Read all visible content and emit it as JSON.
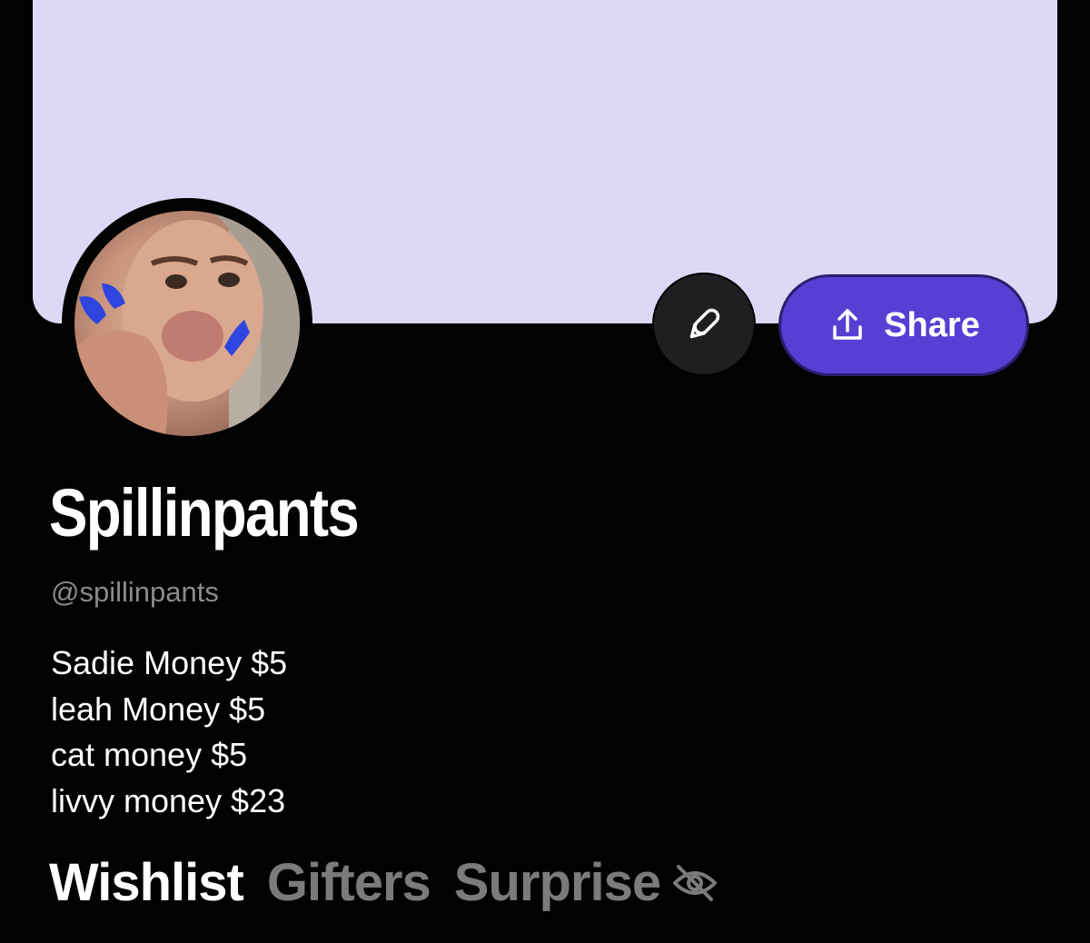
{
  "profile": {
    "display_name": "Spillinpants",
    "handle": "@spillinpants",
    "bio_lines": [
      "Sadie Money $5",
      "leah Money $5",
      "cat money $5",
      "livvy money $23"
    ]
  },
  "actions": {
    "share_label": "Share",
    "edit_icon": "pencil-icon",
    "share_icon": "share-upload-icon"
  },
  "tabs": [
    {
      "label": "Wishlist",
      "state": "active"
    },
    {
      "label": "Gifters",
      "state": "inactive"
    },
    {
      "label": "Surprise",
      "state": "inactive",
      "icon": "eye-off-icon"
    }
  ],
  "colors": {
    "banner": "#dcd8f5",
    "background": "#030203",
    "share_button": "#5640d4",
    "edit_button": "#1f1f21",
    "muted_text": "#8b8b8e"
  }
}
